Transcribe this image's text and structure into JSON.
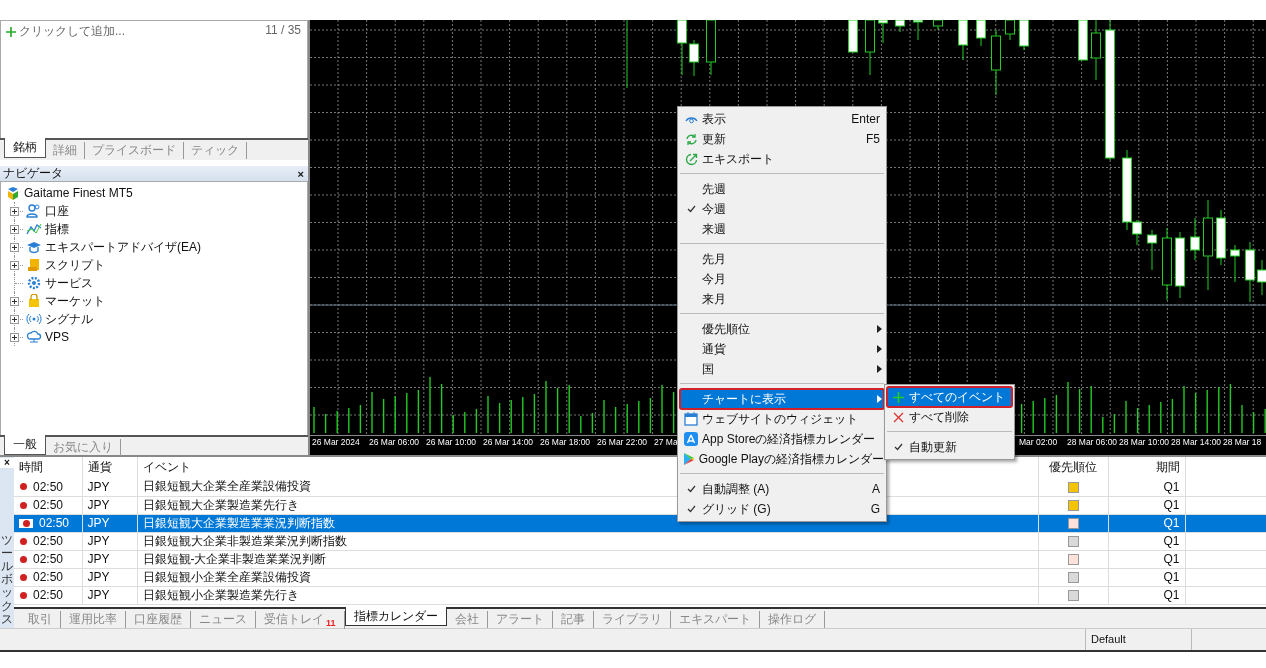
{
  "market_watch": {
    "add_label": "クリックして追加...",
    "count": "11 / 35",
    "tabs": [
      {
        "label": "銘柄",
        "selected": true
      },
      {
        "label": "詳細",
        "selected": false
      },
      {
        "label": "プライスボード",
        "selected": false
      },
      {
        "label": "ティック",
        "selected": false
      }
    ]
  },
  "navigator": {
    "title": "ナビゲータ",
    "close": "×",
    "root": {
      "label": "Gaitame Finest MT5",
      "children": [
        {
          "label": "口座",
          "expandable": true
        },
        {
          "label": "指標",
          "expandable": true
        },
        {
          "label": "エキスパートアドバイザ(EA)",
          "expandable": true
        },
        {
          "label": "スクリプト",
          "expandable": true
        },
        {
          "label": "サービス",
          "expandable": false
        },
        {
          "label": "マーケット",
          "expandable": true
        },
        {
          "label": "シグナル",
          "expandable": true
        },
        {
          "label": "VPS",
          "expandable": true
        }
      ]
    },
    "tabs": [
      {
        "label": "一般",
        "selected": true
      },
      {
        "label": "お気に入り",
        "selected": false
      }
    ]
  },
  "chart": {
    "x_labels_left": [
      "26 Mar 2024",
      "26 Mar 06:00",
      "26 Mar 10:00",
      "26 Mar 14:00",
      "26 Mar 18:00",
      "26 Mar 22:00",
      "27 Ma"
    ],
    "x_labels_right": [
      "Mar 02:00",
      "28 Mar 06:00",
      "28 Mar 10:00",
      "28 Mar 14:00",
      "28 Mar 18"
    ]
  },
  "context_menu": {
    "items": [
      {
        "kind": "item",
        "label": "表示",
        "shortcut": "Enter",
        "checked": false,
        "submenu": false,
        "selected": false
      },
      {
        "kind": "item",
        "label": "更新",
        "shortcut": "F5",
        "checked": false,
        "submenu": false,
        "selected": false
      },
      {
        "kind": "item",
        "label": "エキスポート",
        "checked": false,
        "submenu": false,
        "selected": false
      },
      {
        "kind": "separator"
      },
      {
        "kind": "item",
        "label": "先週",
        "checked": false,
        "submenu": false,
        "selected": false
      },
      {
        "kind": "item",
        "label": "今週",
        "checked": true,
        "submenu": false,
        "selected": false
      },
      {
        "kind": "item",
        "label": "来週",
        "checked": false,
        "submenu": false,
        "selected": false
      },
      {
        "kind": "separator"
      },
      {
        "kind": "item",
        "label": "先月",
        "checked": false,
        "submenu": false,
        "selected": false
      },
      {
        "kind": "item",
        "label": "今月",
        "checked": false,
        "submenu": false,
        "selected": false
      },
      {
        "kind": "item",
        "label": "来月",
        "checked": false,
        "submenu": false,
        "selected": false
      },
      {
        "kind": "separator"
      },
      {
        "kind": "item",
        "label": "優先順位",
        "checked": false,
        "submenu": true,
        "selected": false
      },
      {
        "kind": "item",
        "label": "通貨",
        "checked": false,
        "submenu": true,
        "selected": false
      },
      {
        "kind": "item",
        "label": "国",
        "checked": false,
        "submenu": true,
        "selected": false
      },
      {
        "kind": "separator"
      },
      {
        "kind": "item",
        "label": "チャートに表示",
        "checked": false,
        "submenu": true,
        "selected": true
      },
      {
        "kind": "item",
        "label": "ウェブサイトのウィジェット",
        "checked": false,
        "submenu": false,
        "selected": false
      },
      {
        "kind": "item",
        "label": "App Storeの経済指標カレンダー",
        "checked": false,
        "submenu": false,
        "selected": false
      },
      {
        "kind": "item",
        "label": "Google Playの経済指標カレンダー",
        "checked": false,
        "submenu": false,
        "selected": false
      },
      {
        "kind": "separator"
      },
      {
        "kind": "item",
        "label": "自動調整 (A)",
        "shortcut": "A",
        "checked": true,
        "submenu": false,
        "selected": false
      },
      {
        "kind": "item",
        "label": "グリッド (G)",
        "shortcut": "G",
        "checked": true,
        "submenu": false,
        "selected": false
      }
    ]
  },
  "submenu": {
    "items": [
      {
        "kind": "item",
        "label": "すべてのイベント",
        "checked": false,
        "submenu": false,
        "selected": true
      },
      {
        "kind": "item",
        "label": "すべて削除",
        "checked": false,
        "submenu": false,
        "selected": false
      },
      {
        "kind": "separator"
      },
      {
        "kind": "item",
        "label": "自動更新",
        "checked": true,
        "submenu": false,
        "selected": false
      }
    ]
  },
  "toolbox": {
    "title": "ツールボックス",
    "close": "×",
    "calendar": {
      "columns": [
        "時間",
        "通貨",
        "イベント",
        "優先順位",
        "期間"
      ],
      "rows": [
        {
          "time": "02:50",
          "currency": "JPY",
          "event": "日銀短観大企業全産業設備投資",
          "priority": {
            "color": "#f5c400"
          },
          "period": "Q1",
          "selected": false
        },
        {
          "time": "02:50",
          "currency": "JPY",
          "event": "日銀短観大企業製造業先行き",
          "priority": {
            "color": "#f5c400"
          },
          "period": "Q1",
          "selected": false
        },
        {
          "time": "02:50",
          "currency": "JPY",
          "event": "日銀短観大企業製造業業況判断指数",
          "priority": {
            "color": "#fde2dc"
          },
          "period": "Q1",
          "selected": true
        },
        {
          "time": "02:50",
          "currency": "JPY",
          "event": "日銀短観大企業非製造業業況判断指数",
          "priority": {
            "color": "#d9d9d9"
          },
          "period": "Q1",
          "selected": false
        },
        {
          "time": "02:50",
          "currency": "JPY",
          "event": "日銀短観-大企業非製造業業況判断",
          "priority": {
            "color": "#fde2dc"
          },
          "period": "Q1",
          "selected": false
        },
        {
          "time": "02:50",
          "currency": "JPY",
          "event": "日銀短観小企業全産業設備投資",
          "priority": {
            "color": "#d9d9d9"
          },
          "period": "Q1",
          "selected": false
        },
        {
          "time": "02:50",
          "currency": "JPY",
          "event": "日銀短観小企業製造業先行き",
          "priority": {
            "color": "#d9d9d9"
          },
          "period": "Q1",
          "selected": false
        }
      ]
    },
    "tabs": [
      {
        "label": "取引",
        "selected": false
      },
      {
        "label": "運用比率",
        "selected": false
      },
      {
        "label": "口座履歴",
        "selected": false
      },
      {
        "label": "ニュース",
        "selected": false
      },
      {
        "label": "受信トレイ",
        "badge": "11",
        "selected": false
      },
      {
        "label": "指標カレンダー",
        "selected": true
      },
      {
        "label": "会社",
        "selected": false
      },
      {
        "label": "アラート",
        "selected": false
      },
      {
        "label": "記事",
        "selected": false
      },
      {
        "label": "ライブラリ",
        "selected": false
      },
      {
        "label": "エキスパート",
        "selected": false
      },
      {
        "label": "操作ログ",
        "selected": false
      }
    ]
  },
  "status_bar": {
    "cells": [
      "Default"
    ]
  }
}
